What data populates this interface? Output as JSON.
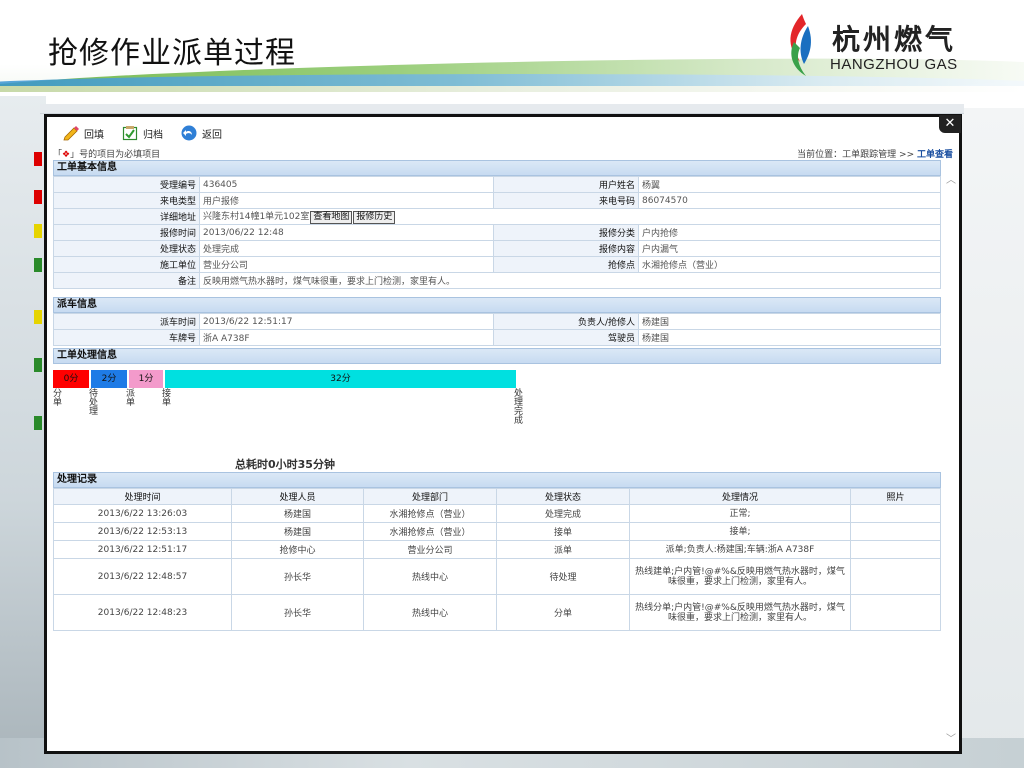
{
  "slide": {
    "title": "抢修作业派单过程",
    "logo_cn": "杭州燃气",
    "logo_en": "HANGZHOU GAS"
  },
  "toolbar": {
    "fill_label": "回填",
    "archive_label": "归档",
    "back_label": "返回"
  },
  "modal": {
    "required_note_prefix": "「",
    "required_mark": "❖",
    "required_note_suffix": "」号的项目为必填项目",
    "breadcrumb_prefix": "当前位置：工单跟踪管理 >> ",
    "breadcrumb_current": "工单查看",
    "close_symbol": "✕"
  },
  "basic": {
    "header": "工单基本信息",
    "accept_no_label": "受理编号",
    "accept_no": "436405",
    "user_name_label": "用户姓名",
    "user_name": "杨翼",
    "call_type_label": "来电类型",
    "call_type": "用户报修",
    "call_no_label": "来电号码",
    "call_no": "86074570",
    "address_label": "详细地址",
    "address": "兴隆东村14幢1单元102室",
    "map_btn": "查看地图",
    "history_btn": "报修历史",
    "repair_time_label": "报修时间",
    "repair_time": "2013/06/22 12:48",
    "repair_cat_label": "报修分类",
    "repair_cat": "户内抢修",
    "status_label": "处理状态",
    "status": "处理完成",
    "repair_content_label": "报修内容",
    "repair_content": "户内漏气",
    "unit_label": "施工单位",
    "unit": "营业分公司",
    "point_label": "抢修点",
    "point": "水湘抢修点（营业）",
    "remark_label": "备注",
    "remark": "反映用燃气热水器时，煤气味很重，要求上门检测，家里有人。"
  },
  "dispatch": {
    "header": "派车信息",
    "time_label": "派车时间",
    "time": "2013/6/22 12:51:17",
    "leader_label": "负责人/抢修人",
    "leader": "杨建国",
    "plate_label": "车牌号",
    "plate": "浙A A738F",
    "driver_label": "驾驶员",
    "driver": "杨建国"
  },
  "process": {
    "header": "工单处理信息",
    "segments": [
      "0分",
      "2分",
      "1分",
      "32分"
    ],
    "stage_labels": [
      "分单",
      "待处理",
      "派单",
      "接单",
      "处理完成"
    ],
    "total": "总耗时0小时35分钟",
    "colors": [
      "#ff0000",
      "#1e7be6",
      "#f39acb",
      "#00e0e0"
    ],
    "segment_minutes": [
      0,
      2,
      1,
      32
    ]
  },
  "records": {
    "header": "处理记录",
    "columns": [
      "处理时间",
      "处理人员",
      "处理部门",
      "处理状态",
      "处理情况",
      "照片"
    ],
    "rows": [
      [
        "2013/6/22 13:26:03",
        "杨建国",
        "水湘抢修点（营业）",
        "处理完成",
        "正常;",
        ""
      ],
      [
        "2013/6/22 12:53:13",
        "杨建国",
        "水湘抢修点（营业）",
        "接单",
        "接单;",
        ""
      ],
      [
        "2013/6/22 12:51:17",
        "抢修中心",
        "营业分公司",
        "派单",
        "派单;负责人:杨建国;车辆:浙A A738F",
        ""
      ],
      [
        "2013/6/22 12:48:57",
        "孙长华",
        "热线中心",
        "待处理",
        "热线建单;户内管!@#%&反映用燃气热水器时，煤气味很重，要求上门检测，家里有人。",
        ""
      ],
      [
        "2013/6/22 12:48:23",
        "孙长华",
        "热线中心",
        "分单",
        "热线分单;户内管!@#%&反映用燃气热水器时，煤气味很重，要求上门检测，家里有人。",
        ""
      ]
    ]
  }
}
